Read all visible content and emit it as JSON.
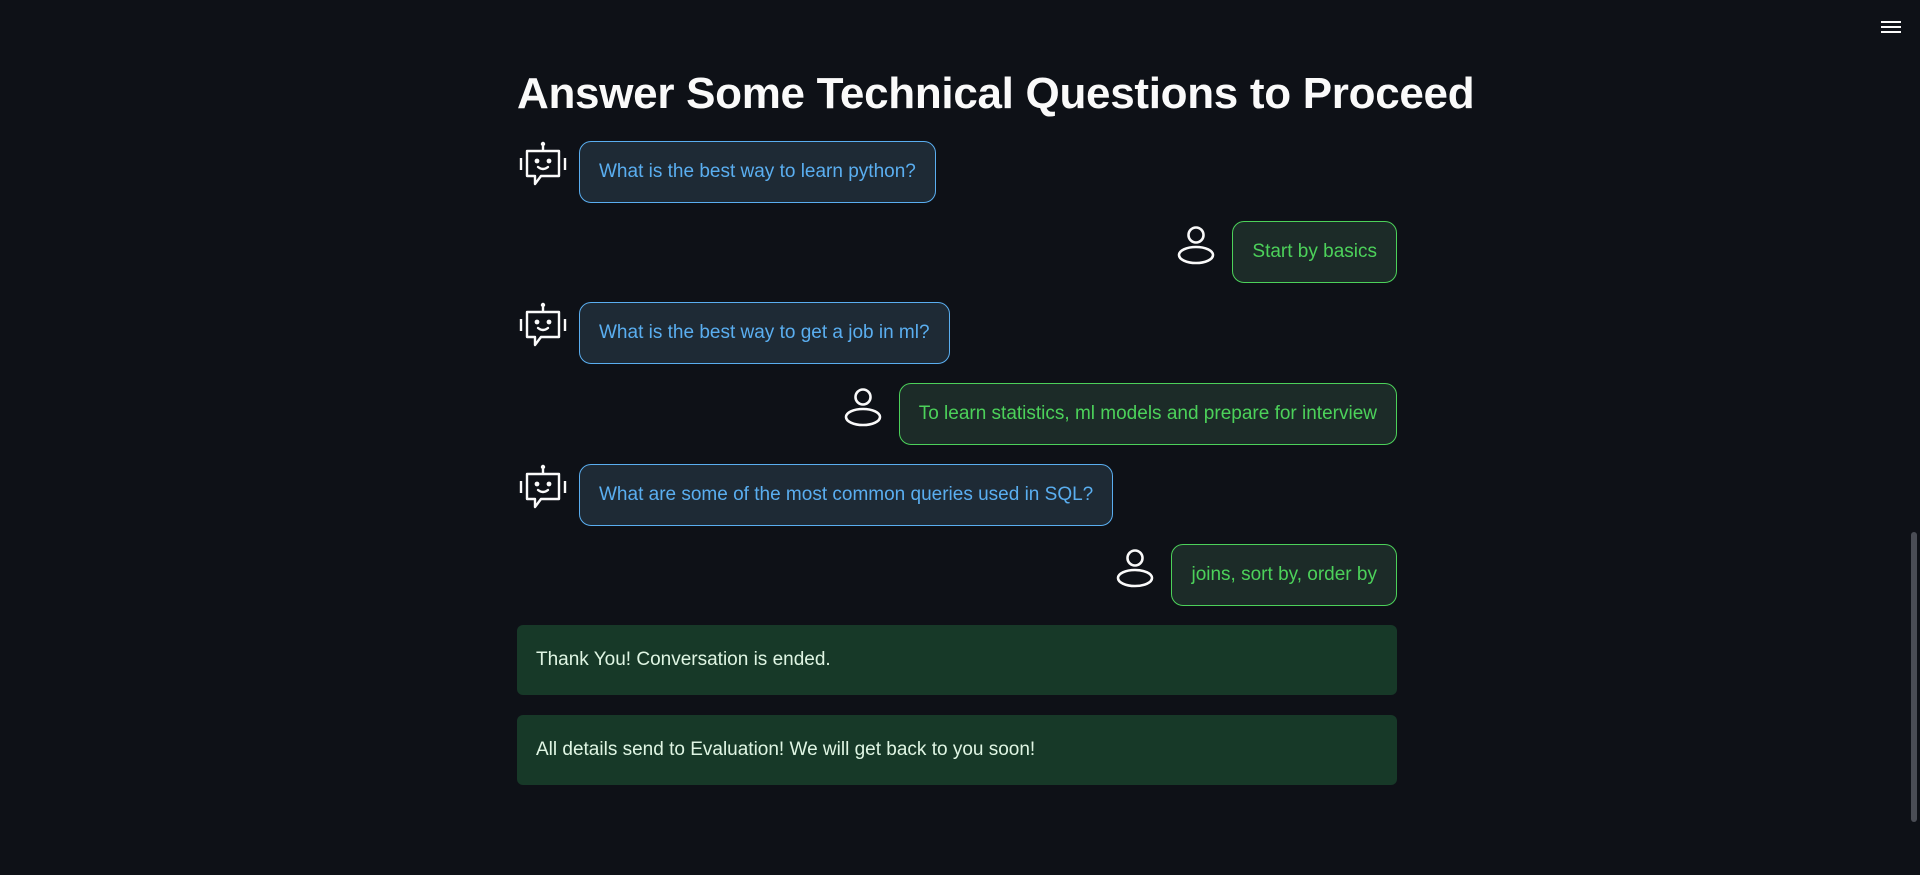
{
  "header": {
    "menu_icon": "hamburger-menu-icon"
  },
  "page": {
    "title": "Answer Some Technical Questions to Proceed"
  },
  "colors": {
    "background": "#0e1117",
    "bot_text": "#5aaef0",
    "user_text": "#4cd15a",
    "success_bg": "#173928"
  },
  "chat": {
    "messages": [
      {
        "role": "bot",
        "icon": "robot-icon",
        "text": "What is the best way to learn python?"
      },
      {
        "role": "user",
        "icon": "user-icon",
        "text": "Start by basics"
      },
      {
        "role": "bot",
        "icon": "robot-icon",
        "text": "What is the best way to get a job in ml?"
      },
      {
        "role": "user",
        "icon": "user-icon",
        "text": "To learn statistics, ml models and prepare for interview"
      },
      {
        "role": "bot",
        "icon": "robot-icon",
        "text": "What are some of the most common queries used in SQL?"
      },
      {
        "role": "user",
        "icon": "user-icon",
        "text": "joins, sort by, order by"
      }
    ]
  },
  "alerts": [
    {
      "text": "Thank You! Conversation is ended."
    },
    {
      "text": "All details send to Evaluation! We will get back to you soon!"
    }
  ]
}
